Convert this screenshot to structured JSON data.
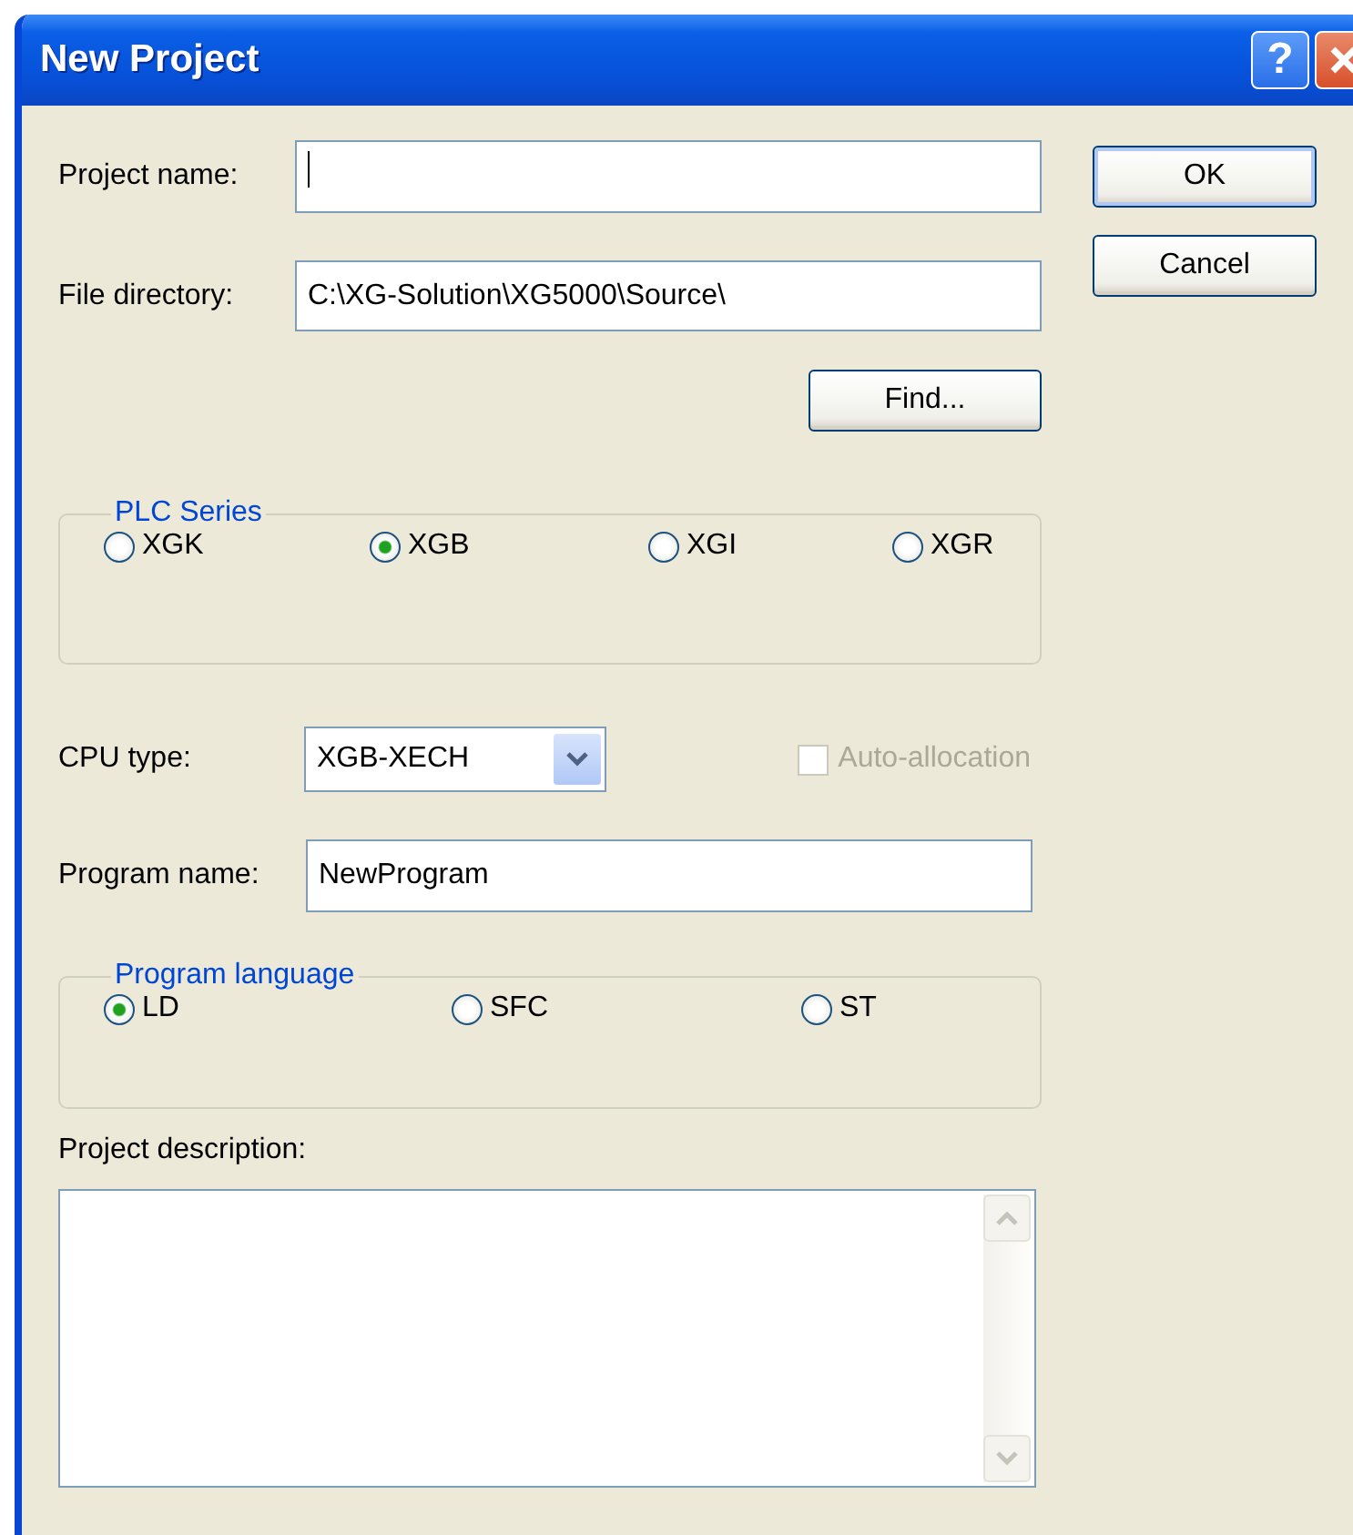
{
  "window": {
    "title": "New Project",
    "help_button": "?"
  },
  "project_name": {
    "label": "Project name:",
    "focused": true
  },
  "file_directory": {
    "label": "File directory:",
    "value": "C:\\XG-Solution\\XG5000\\Source\\"
  },
  "find_button": "Find...",
  "plc_series": {
    "title": "PLC Series",
    "options": [
      {
        "label": "XGK",
        "selected": false
      },
      {
        "label": "XGB",
        "selected": true
      },
      {
        "label": "XGI",
        "selected": false
      },
      {
        "label": "XGR",
        "selected": false
      }
    ]
  },
  "cpu_type": {
    "label": "CPU type:",
    "value": "XGB-XECH"
  },
  "auto_allocation": {
    "label": "Auto-allocation",
    "checked": false,
    "disabled": true
  },
  "program_name": {
    "label": "Program name:",
    "value": "NewProgram"
  },
  "program_language": {
    "title": "Program language",
    "options": [
      {
        "label": "LD",
        "selected": true
      },
      {
        "label": "SFC",
        "selected": false
      },
      {
        "label": "ST",
        "selected": false
      }
    ]
  },
  "project_description": {
    "label": "Project description:"
  },
  "buttons": [
    {
      "label": "OK",
      "default": true
    },
    {
      "label": "Cancel",
      "default": false
    }
  ]
}
